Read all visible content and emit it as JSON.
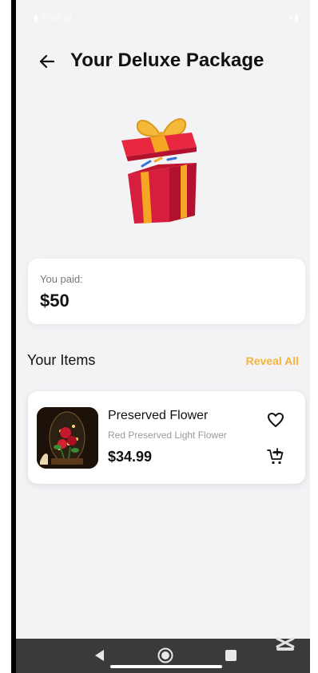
{
  "status_bar": {
    "left_text": "· ▮ ▽ ııl ııl",
    "right_text": "▾ ▮"
  },
  "header": {
    "title": "Your Deluxe Package",
    "back_icon": "arrow-left-icon"
  },
  "gift": {
    "icon": "gift-box-icon",
    "colors": {
      "box": "#d81e3f",
      "stripe": "#f5a623",
      "ribbon": "#f5b93a"
    }
  },
  "payment": {
    "label": "You paid:",
    "amount": "$50"
  },
  "items_section": {
    "title": "Your Items",
    "reveal_label": "Reveal All",
    "accent_color": "#f2b43a"
  },
  "items": [
    {
      "name": "Preserved Flower",
      "subtitle": "Red Preserved Light Flower",
      "price": "$34.99",
      "image_icon": "rose-dome-image",
      "favorite_icon": "heart-outline-icon",
      "cart_icon": "add-to-cart-icon"
    }
  ],
  "nav_bar": {
    "back_icon": "triangle-back-icon",
    "home_icon": "circle-home-icon",
    "recent_icon": "square-recents-icon"
  }
}
